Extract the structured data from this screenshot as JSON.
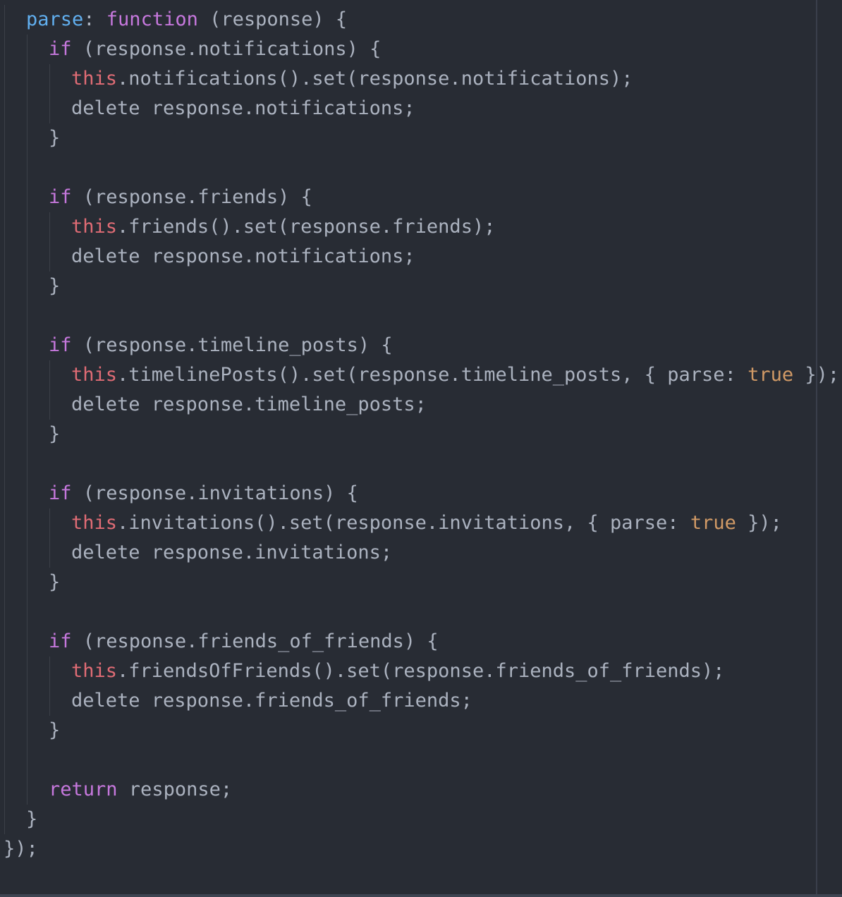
{
  "colors": {
    "background": "#282c34",
    "plain": "#abb2bf",
    "keyword": "#c678dd",
    "property": "#61afef",
    "this": "#e06c75",
    "boolean": "#d19a66"
  },
  "lines": [
    {
      "indent": 1,
      "tokens": [
        [
          "property",
          "parse"
        ],
        [
          "plain",
          ": "
        ],
        [
          "keyword",
          "function"
        ],
        [
          "plain",
          " (response) {"
        ]
      ]
    },
    {
      "indent": 2,
      "tokens": [
        [
          "keyword",
          "if"
        ],
        [
          "plain",
          " (response.notifications) {"
        ]
      ]
    },
    {
      "indent": 3,
      "tokens": [
        [
          "this",
          "this"
        ],
        [
          "plain",
          ".notifications().set(response.notifications);"
        ]
      ]
    },
    {
      "indent": 3,
      "tokens": [
        [
          "plain",
          "delete response.notifications;"
        ]
      ]
    },
    {
      "indent": 2,
      "tokens": [
        [
          "plain",
          "}"
        ]
      ]
    },
    {
      "indent": 0,
      "tokens": []
    },
    {
      "indent": 2,
      "tokens": [
        [
          "keyword",
          "if"
        ],
        [
          "plain",
          " (response.friends) {"
        ]
      ]
    },
    {
      "indent": 3,
      "tokens": [
        [
          "this",
          "this"
        ],
        [
          "plain",
          ".friends().set(response.friends);"
        ]
      ]
    },
    {
      "indent": 3,
      "tokens": [
        [
          "plain",
          "delete response.notifications;"
        ]
      ]
    },
    {
      "indent": 2,
      "tokens": [
        [
          "plain",
          "}"
        ]
      ]
    },
    {
      "indent": 0,
      "tokens": []
    },
    {
      "indent": 2,
      "tokens": [
        [
          "keyword",
          "if"
        ],
        [
          "plain",
          " (response.timeline_posts) {"
        ]
      ]
    },
    {
      "indent": 3,
      "tokens": [
        [
          "this",
          "this"
        ],
        [
          "plain",
          ".timelinePosts().set(response.timeline_posts, { parse: "
        ],
        [
          "boolean",
          "true"
        ],
        [
          "plain",
          " });"
        ]
      ]
    },
    {
      "indent": 3,
      "tokens": [
        [
          "plain",
          "delete response.timeline_posts;"
        ]
      ]
    },
    {
      "indent": 2,
      "tokens": [
        [
          "plain",
          "}"
        ]
      ]
    },
    {
      "indent": 0,
      "tokens": []
    },
    {
      "indent": 2,
      "tokens": [
        [
          "keyword",
          "if"
        ],
        [
          "plain",
          " (response.invitations) {"
        ]
      ]
    },
    {
      "indent": 3,
      "tokens": [
        [
          "this",
          "this"
        ],
        [
          "plain",
          ".invitations().set(response.invitations, { parse: "
        ],
        [
          "boolean",
          "true"
        ],
        [
          "plain",
          " });"
        ]
      ]
    },
    {
      "indent": 3,
      "tokens": [
        [
          "plain",
          "delete response.invitations;"
        ]
      ]
    },
    {
      "indent": 2,
      "tokens": [
        [
          "plain",
          "}"
        ]
      ]
    },
    {
      "indent": 0,
      "tokens": []
    },
    {
      "indent": 2,
      "tokens": [
        [
          "keyword",
          "if"
        ],
        [
          "plain",
          " (response.friends_of_friends) {"
        ]
      ]
    },
    {
      "indent": 3,
      "tokens": [
        [
          "this",
          "this"
        ],
        [
          "plain",
          ".friendsOfFriends().set(response.friends_of_friends);"
        ]
      ]
    },
    {
      "indent": 3,
      "tokens": [
        [
          "plain",
          "delete response.friends_of_friends;"
        ]
      ]
    },
    {
      "indent": 2,
      "tokens": [
        [
          "plain",
          "}"
        ]
      ]
    },
    {
      "indent": 0,
      "tokens": []
    },
    {
      "indent": 2,
      "tokens": [
        [
          "keyword",
          "return"
        ],
        [
          "plain",
          " response;"
        ]
      ]
    },
    {
      "indent": 1,
      "tokens": [
        [
          "plain",
          "}"
        ]
      ]
    },
    {
      "indent": 0,
      "tokens": [
        [
          "plain",
          "});"
        ]
      ]
    }
  ]
}
